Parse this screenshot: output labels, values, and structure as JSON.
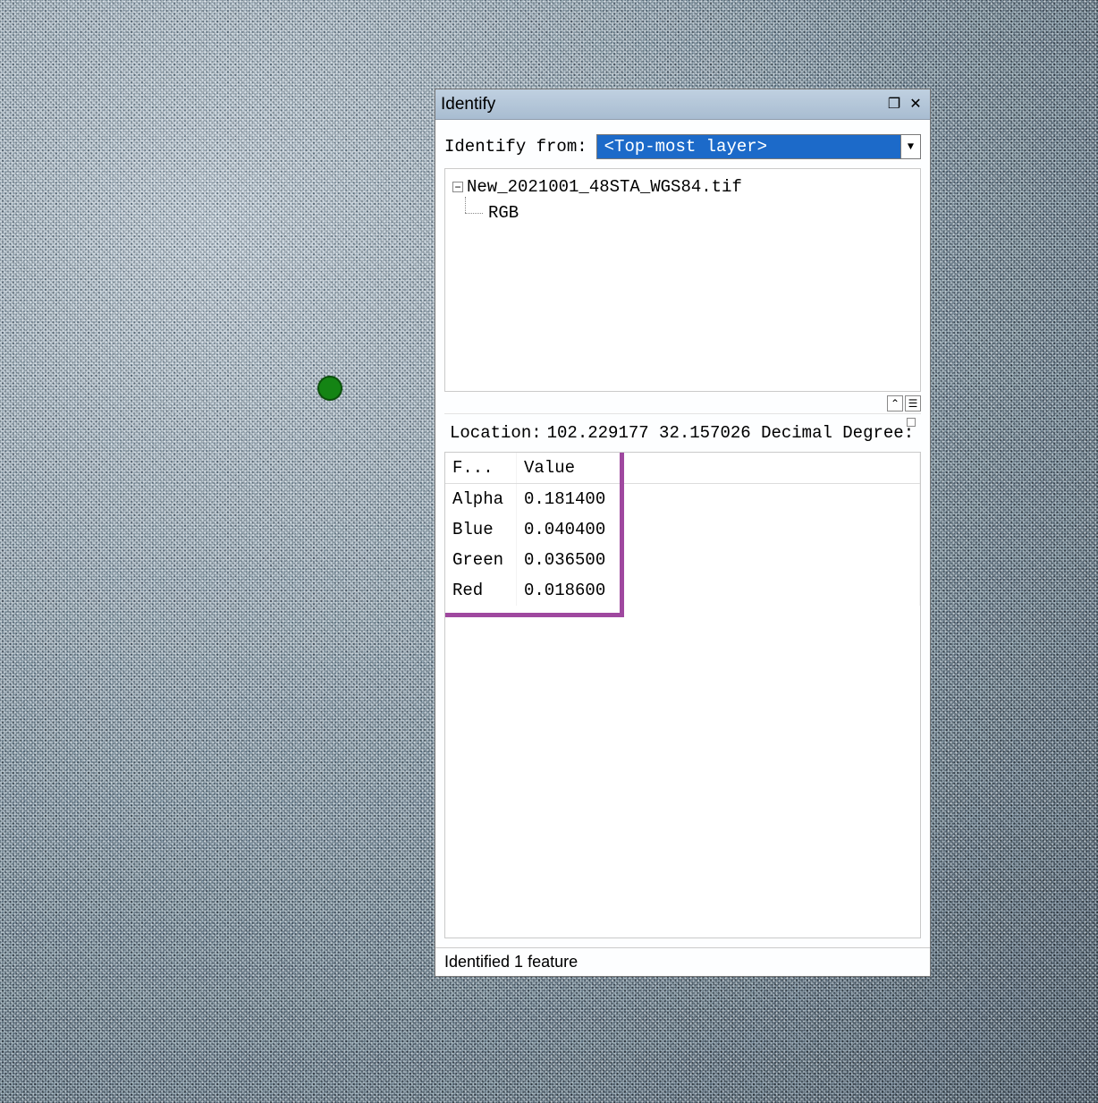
{
  "panel": {
    "title": "Identify",
    "identify_from_label": "Identify from:",
    "identify_from_value": "<Top-most layer>",
    "tree": {
      "root": "New_2021001_48STA_WGS84.tif",
      "child": "RGB"
    },
    "location_label": "Location:",
    "location_value": "102.229177  32.157026 Decimal Degree:",
    "table": {
      "headers": {
        "field": "F...",
        "value": "Value"
      },
      "rows": [
        {
          "field": "Alpha",
          "value": "0.181400"
        },
        {
          "field": "Blue",
          "value": "0.040400"
        },
        {
          "field": "Green",
          "value": "0.036500"
        },
        {
          "field": "Red",
          "value": "0.018600"
        }
      ]
    },
    "status": "Identified 1 feature"
  },
  "icons": {
    "restore": "❐",
    "close": "✕",
    "caret": "▼",
    "minus": "−",
    "up_double": "⌃",
    "menu": "☰"
  }
}
